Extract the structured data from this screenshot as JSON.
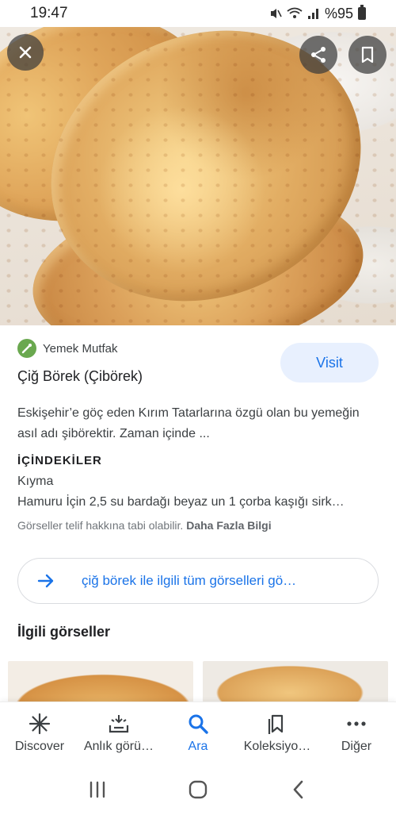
{
  "status_bar": {
    "time": "19:47",
    "battery": "%95",
    "icons": [
      "mute-icon",
      "wifi-icon",
      "signal-icon",
      "battery-icon"
    ]
  },
  "hero": {
    "image": "cig-borek-photo",
    "close_icon": "close-icon",
    "share_icon": "share-icon",
    "save_icon": "bookmark-icon"
  },
  "result": {
    "source": "Yemek Mutfak",
    "title": "Çiğ Börek (Çibörek)",
    "visit_label": "Visit",
    "description": "Eskişehir’e göç eden Kırım Tatarlarına özgü olan bu yemeğin asıl adı şibörektir. Zaman içinde ...",
    "ingredients_heading": "İÇİNDEKİLER",
    "ingredient_1": "Kıyma",
    "ingredient_2": "Hamuru İçin 2,5 su bardağı beyaz un 1 çorba kaşığı sirk…",
    "copyright": "Görseller telif hakkına tabi olabilir.",
    "more_info": "Daha Fazla Bilgi"
  },
  "all_images_label": "çiğ börek ile ilgili tüm görselleri gö…",
  "related_heading": "İlgili görseller",
  "bottom_nav": {
    "discover": "Discover",
    "snapshot": "Anlık görü…",
    "search": "Ara",
    "collections": "Koleksiyo…",
    "more": "Diğer"
  },
  "colors": {
    "accent": "#1a73e8",
    "visit_bg": "#e8f0fe",
    "favicon": "#6aa84f"
  }
}
